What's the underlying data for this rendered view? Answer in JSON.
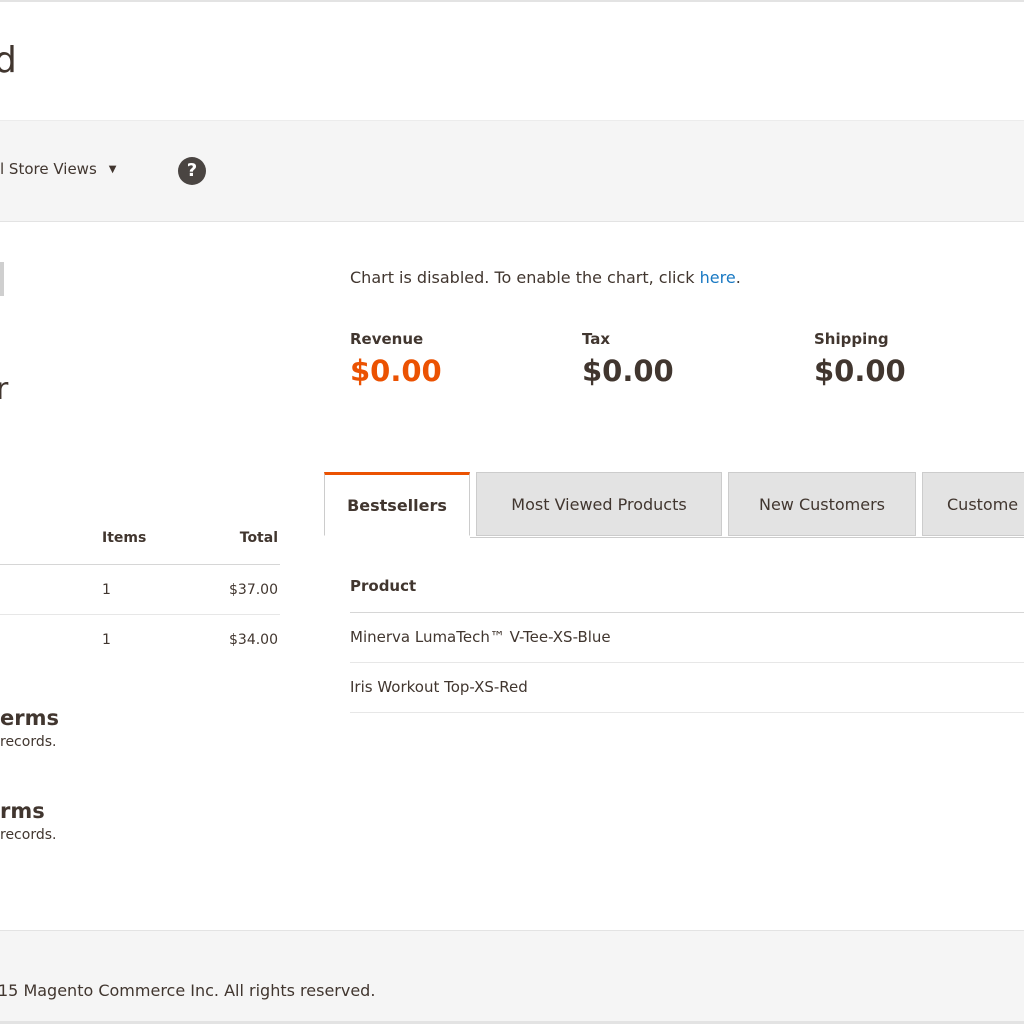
{
  "page": {
    "title": "d"
  },
  "scope": {
    "store_views_label": "l Store Views",
    "help_icon_glyph": "?"
  },
  "left": {
    "edge_glyph": "r",
    "orders": {
      "headers": {
        "items": "Items",
        "total": "Total"
      },
      "rows": [
        {
          "items": "1",
          "total": "$37.00"
        },
        {
          "items": "1",
          "total": "$34.00"
        }
      ]
    },
    "last_search_terms": {
      "title": "erms",
      "sub": "records."
    },
    "top_search_terms": {
      "title": "rms",
      "sub": "records."
    }
  },
  "chart": {
    "note_prefix": "Chart is disabled. To enable the chart, click ",
    "note_link": "here",
    "note_suffix": "."
  },
  "totals": {
    "revenue": {
      "label": "Revenue",
      "value": "$0.00"
    },
    "tax": {
      "label": "Tax",
      "value": "$0.00"
    },
    "shipping": {
      "label": "Shipping",
      "value": "$0.00"
    }
  },
  "tabs": [
    {
      "label": "Bestsellers"
    },
    {
      "label": "Most Viewed Products"
    },
    {
      "label": "New Customers"
    },
    {
      "label": "Custome"
    }
  ],
  "products": {
    "header": "Product",
    "rows": [
      {
        "name": "Minerva LumaTech™ V-Tee-XS-Blue"
      },
      {
        "name": "Iris Workout Top-XS-Red"
      }
    ]
  },
  "footer": {
    "copyright": "15 Magento Commerce Inc. All rights reserved."
  },
  "colors": {
    "accent": "#eb5202",
    "link": "#1979c3",
    "text": "#41362f"
  }
}
